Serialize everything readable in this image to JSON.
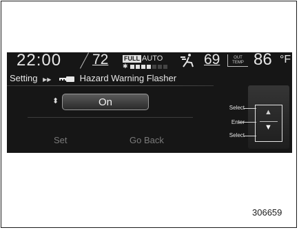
{
  "header": {
    "clock": "22:00",
    "left_temp": "72",
    "fan_badge": "FULL",
    "fan_mode": "AUTO",
    "fan_levels_on": 4,
    "fan_levels_total": 7,
    "right_temp": "69",
    "out_badge_line1": "OUT",
    "out_badge_line2": "TEMP",
    "out_temp": "86",
    "out_temp_unit": "°F"
  },
  "breadcrumb": {
    "root": "Setting",
    "arrows": "▶▶",
    "item": "Hazard Warning Flasher"
  },
  "setting": {
    "value": "On"
  },
  "buttons": {
    "set": "Set",
    "go_back": "Go Back"
  },
  "controls": {
    "select_top": "Select",
    "enter": "Enter",
    "select_bottom": "Select"
  },
  "figure": {
    "ref_number": "306659"
  }
}
